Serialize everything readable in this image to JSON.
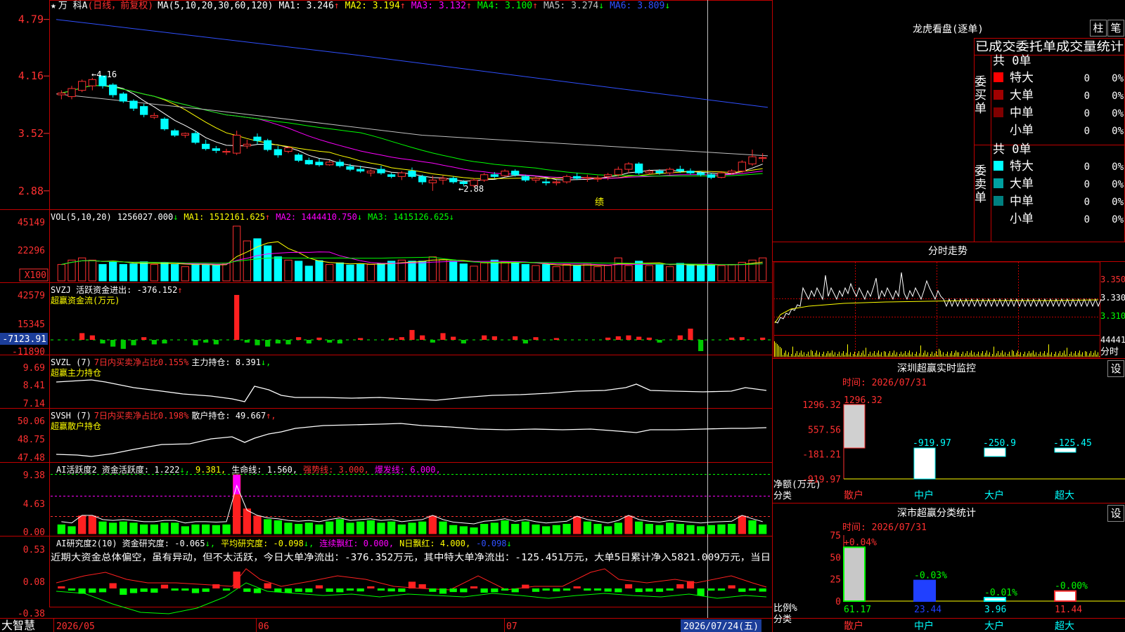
{
  "app_name": "大智慧",
  "title_bar": {
    "star": "★",
    "stock_name": "万 科A",
    "period": "(日线，前复权)",
    "ma_params": "MA(5,10,20,30,60,120)",
    "ma_values": [
      {
        "label": "MA1: 3.246",
        "arrow": "↑",
        "color": "#ffffff"
      },
      {
        "label": "MA2: 3.194",
        "arrow": "↑",
        "color": "#ffff00"
      },
      {
        "label": "MA3: 3.132",
        "arrow": "↑",
        "color": "#ff00ff"
      },
      {
        "label": "MA4: 3.100",
        "arrow": "↑",
        "color": "#00ff00"
      },
      {
        "label": "MA5: 3.274",
        "arrow": "↓",
        "color": "#c0c0c0"
      },
      {
        "label": "MA6: 3.809",
        "arrow": "↓",
        "color": "#3050ff"
      }
    ]
  },
  "price_axis": [
    "4.79",
    "4.16",
    "3.52",
    "2.88"
  ],
  "price_annotations": {
    "high": "←4.16",
    "low": "←2.88",
    "event": "绩"
  },
  "vol_pane": {
    "header": "VOL(5,10,20)",
    "items": [
      {
        "label": "1256027.000",
        "arrow": "↓",
        "color": "#ffffff"
      },
      {
        "label": "MA1: 1512161.625",
        "arrow": "↑",
        "color": "#ffff00"
      },
      {
        "label": "MA2: 1444410.750",
        "arrow": "↓",
        "color": "#ff00ff"
      },
      {
        "label": "MA3: 1415126.625",
        "arrow": "↓",
        "color": "#00ff00"
      }
    ],
    "axis": [
      "45149",
      "22296"
    ],
    "unit": "X100"
  },
  "svzj_pane": {
    "header": "SVZJ 活跃资金进出: -376.152",
    "arrow": "↑",
    "subtitle": "超赢资金流(万元)",
    "axis": [
      "42579",
      "15345",
      "-11890"
    ],
    "current": "-7123.91"
  },
  "svzl_pane": {
    "header": "SVZL (7)",
    "ratio": "7日内买卖净占比0.155%",
    "hold": "主力持仓: 8.391",
    "arrow": "↓,",
    "subtitle": "超赢主力持仓",
    "axis": [
      "9.69",
      "8.41",
      "7.14"
    ]
  },
  "svsh_pane": {
    "header": "SVSH (7)",
    "ratio": "7日内买卖净占比0.198%",
    "hold": "散户持仓: 49.667",
    "arrow": "↑,",
    "subtitle": "超赢散户持仓",
    "axis": [
      "50.06",
      "48.75",
      "47.48"
    ]
  },
  "ai1_pane": {
    "items": [
      {
        "label": "AI活跃度2 资金活跃度: 1.222",
        "arrow": "↓,",
        "color": "#ffffff"
      },
      {
        "label": "9.381,",
        "arrow": "",
        "color": "#ffff00"
      },
      {
        "label": "生命线: 1.560,",
        "arrow": "",
        "color": "#ffffff"
      },
      {
        "label": "强势线: 3.000,",
        "arrow": "",
        "color": "#ff3030"
      },
      {
        "label": "爆发线: 6.000,",
        "arrow": "",
        "color": "#ff00ff"
      }
    ],
    "axis": [
      "9.38",
      "4.63",
      "0.00"
    ]
  },
  "ai2_pane": {
    "items": [
      {
        "label": "AI研究度2(10) 资金研究度: -0.065",
        "arrow": "↓,",
        "color": "#ffffff"
      },
      {
        "label": "平均研究度: -0.098",
        "arrow": "↓,",
        "color": "#ffff00"
      },
      {
        "label": "连续飘红: 0.000,",
        "arrow": "",
        "color": "#ff00ff"
      },
      {
        "label": "N日飘红: 4.000,",
        "arrow": "",
        "color": "#ffff00"
      },
      {
        "label": "-0.098",
        "arrow": "↓",
        "color": "#3050ff"
      }
    ],
    "comment": "近期大资金总体偏空，虽有异动，但不太活跃，今日大单净流出：-376.352万元，其中特大单净流出：-125.451万元，大单5日累计净入5821.009万元，当日",
    "axis": [
      "0.53",
      "0.08",
      "-0.38"
    ]
  },
  "date_axis": {
    "labels": [
      "2026/05",
      "06",
      "07"
    ],
    "current": "2026/07/24(五)"
  },
  "right_panel": {
    "lhb_title": "龙虎看盘(逐单)",
    "btn_zhu": "柱",
    "btn_bi": "笔",
    "order_title": "已成交委托单成交量统计",
    "buy_side": {
      "label": "委买单",
      "total": "共 0单",
      "rows": [
        {
          "name": "特大",
          "value": "0",
          "pct": "0%",
          "color": "#ff0000"
        },
        {
          "name": "大单",
          "value": "0",
          "pct": "0%",
          "color": "#a00000"
        },
        {
          "name": "中单",
          "value": "0",
          "pct": "0%",
          "color": "#800000"
        },
        {
          "name": "小单",
          "value": "0",
          "pct": "0%",
          "color": ""
        }
      ]
    },
    "sell_side": {
      "label": "委卖单",
      "total": "共 0单",
      "rows": [
        {
          "name": "特大",
          "value": "0",
          "pct": "0%",
          "color": "#00ffff"
        },
        {
          "name": "大单",
          "value": "0",
          "pct": "0%",
          "color": "#00a0a0"
        },
        {
          "name": "中单",
          "value": "0",
          "pct": "0%",
          "color": "#008080"
        },
        {
          "name": "小单",
          "value": "0",
          "pct": "0%",
          "color": ""
        }
      ]
    },
    "intraday_title": "分时走势",
    "intraday_axis": [
      "3.350",
      "3.330",
      "3.310"
    ],
    "intraday_vol_label": "44441",
    "intraday_tail": "分时",
    "monitor": {
      "title": "深圳超赢实时监控",
      "set": "设",
      "time": "时间: 2026/07/31",
      "axis": [
        "1296.32",
        "557.56",
        "-181.21",
        "-919.97"
      ],
      "unit": "净额(万元)",
      "cat_label": "分类",
      "values": [
        "1296.32",
        "-919.97",
        "-250.9",
        "-125.45"
      ],
      "categories": [
        "散户",
        "中户",
        "大户",
        "超大"
      ]
    },
    "classify": {
      "title": "深市超赢分类统计",
      "set": "设",
      "time": "时间: 2026/07/31",
      "axis": [
        "75",
        "50",
        "25",
        "0"
      ],
      "unit": "比例%",
      "cat_label": "分类",
      "tops": [
        "+0.04%",
        "-0.03%",
        "-0.01%",
        "-0.00%"
      ],
      "values": [
        "61.17",
        "23.44",
        "3.96",
        "11.44"
      ],
      "categories": [
        "散户",
        "中户",
        "大户",
        "超大"
      ]
    }
  },
  "chart_data": {
    "type": "candlestick",
    "ylim": [
      2.8,
      4.85
    ],
    "ohlc": [
      [
        3.95,
        4.0,
        3.9,
        3.97
      ],
      [
        3.93,
        4.05,
        3.9,
        4.02
      ],
      [
        4.0,
        4.12,
        3.98,
        4.1
      ],
      [
        4.05,
        4.14,
        4.0,
        4.12
      ],
      [
        4.16,
        4.16,
        4.02,
        4.05
      ],
      [
        4.06,
        4.08,
        3.92,
        3.95
      ],
      [
        3.96,
        3.98,
        3.86,
        3.88
      ],
      [
        3.88,
        3.9,
        3.77,
        3.8
      ],
      [
        3.82,
        3.85,
        3.7,
        3.73
      ],
      [
        3.7,
        3.75,
        3.68,
        3.72
      ],
      [
        3.68,
        3.7,
        3.55,
        3.57
      ],
      [
        3.55,
        3.57,
        3.48,
        3.5
      ],
      [
        3.5,
        3.53,
        3.47,
        3.52
      ],
      [
        3.52,
        3.55,
        3.4,
        3.42
      ],
      [
        3.4,
        3.45,
        3.33,
        3.35
      ],
      [
        3.35,
        3.38,
        3.3,
        3.33
      ],
      [
        3.32,
        3.35,
        3.28,
        3.32
      ],
      [
        3.3,
        3.55,
        3.28,
        3.5
      ],
      [
        3.38,
        3.45,
        3.35,
        3.4
      ],
      [
        3.48,
        3.52,
        3.4,
        3.44
      ],
      [
        3.44,
        3.46,
        3.32,
        3.34
      ],
      [
        3.34,
        3.38,
        3.25,
        3.28
      ],
      [
        3.32,
        3.38,
        3.3,
        3.36
      ],
      [
        3.28,
        3.3,
        3.2,
        3.22
      ],
      [
        3.22,
        3.25,
        3.17,
        3.18
      ],
      [
        3.2,
        3.24,
        3.15,
        3.17
      ],
      [
        3.17,
        3.22,
        3.16,
        3.2
      ],
      [
        3.2,
        3.23,
        3.14,
        3.16
      ],
      [
        3.15,
        3.18,
        3.1,
        3.12
      ],
      [
        3.12,
        3.16,
        3.08,
        3.1
      ],
      [
        3.08,
        3.12,
        3.04,
        3.1
      ],
      [
        3.12,
        3.16,
        3.06,
        3.08
      ],
      [
        3.06,
        3.08,
        3.02,
        3.04
      ],
      [
        3.04,
        3.1,
        3.0,
        3.08
      ],
      [
        3.1,
        3.14,
        3.02,
        3.04
      ],
      [
        3.04,
        3.06,
        2.95,
        2.98
      ],
      [
        2.97,
        3.05,
        2.88,
        3.0
      ],
      [
        3.0,
        3.05,
        2.95,
        3.02
      ],
      [
        3.02,
        3.04,
        2.96,
        2.98
      ],
      [
        2.98,
        3.0,
        2.93,
        2.96
      ],
      [
        2.94,
        3.02,
        2.92,
        3.0
      ],
      [
        3.0,
        3.08,
        2.98,
        3.06
      ],
      [
        3.06,
        3.09,
        3.02,
        3.04
      ],
      [
        3.05,
        3.12,
        3.04,
        3.1
      ],
      [
        3.1,
        3.12,
        3.04,
        3.06
      ],
      [
        3.04,
        3.06,
        2.98,
        3.0
      ],
      [
        3.0,
        3.04,
        2.97,
        3.02
      ],
      [
        2.98,
        3.02,
        2.94,
        2.97
      ],
      [
        2.97,
        3.0,
        2.94,
        2.98
      ],
      [
        2.98,
        3.06,
        2.96,
        3.04
      ],
      [
        3.04,
        3.08,
        3.0,
        3.02
      ],
      [
        3.02,
        3.06,
        2.98,
        3.03
      ],
      [
        3.01,
        3.05,
        2.98,
        3.02
      ],
      [
        3.04,
        3.08,
        3.0,
        3.06
      ],
      [
        3.06,
        3.15,
        3.04,
        3.12
      ],
      [
        3.12,
        3.2,
        3.08,
        3.18
      ],
      [
        3.18,
        3.2,
        3.06,
        3.08
      ],
      [
        3.08,
        3.12,
        3.06,
        3.1
      ],
      [
        3.1,
        3.12,
        3.06,
        3.08
      ],
      [
        3.08,
        3.14,
        3.06,
        3.12
      ],
      [
        3.12,
        3.16,
        3.08,
        3.1
      ],
      [
        3.1,
        3.13,
        3.06,
        3.08
      ],
      [
        3.08,
        3.1,
        3.04,
        3.06
      ],
      [
        3.06,
        3.08,
        3.01,
        3.03
      ],
      [
        3.03,
        3.1,
        3.02,
        3.08
      ],
      [
        3.08,
        3.12,
        3.06,
        3.1
      ],
      [
        3.1,
        3.22,
        3.08,
        3.2
      ],
      [
        3.18,
        3.34,
        3.16,
        3.26
      ],
      [
        3.25,
        3.3,
        3.2,
        3.25
      ]
    ],
    "vol": [
      0.3,
      0.38,
      0.42,
      0.38,
      0.3,
      0.34,
      0.3,
      0.31,
      0.35,
      0.3,
      0.33,
      0.3,
      0.26,
      0.31,
      0.3,
      0.29,
      0.32,
      1.0,
      0.73,
      0.77,
      0.64,
      0.44,
      0.38,
      0.36,
      0.27,
      0.37,
      0.3,
      0.33,
      0.29,
      0.3,
      0.3,
      0.32,
      0.36,
      0.38,
      0.36,
      0.36,
      0.44,
      0.39,
      0.36,
      0.31,
      0.27,
      0.33,
      0.38,
      0.35,
      0.33,
      0.3,
      0.28,
      0.3,
      0.26,
      0.3,
      0.28,
      0.31,
      0.26,
      0.28,
      0.42,
      0.28,
      0.36,
      0.28,
      0.3,
      0.26,
      0.32,
      0.3,
      0.28,
      0.3,
      0.28,
      0.3,
      0.34,
      0.38,
      0.42
    ],
    "svzj": [
      0,
      0,
      0.15,
      0.1,
      -0.08,
      -0.15,
      -0.2,
      -0.12,
      0.06,
      -0.1,
      -0.08,
      0,
      0,
      -0.12,
      -0.06,
      -0.1,
      0,
      1.0,
      -0.06,
      -0.12,
      -0.15,
      -0.08,
      -0.1,
      0.06,
      -0.08,
      0.05,
      -0.06,
      -0.08,
      0,
      0.04,
      0,
      0,
      0.04,
      0.06,
      0.22,
      0.1,
      -0.06,
      0.15,
      0.07,
      -0.08,
      0,
      0.1,
      0.08,
      0,
      0.08,
      -0.08,
      0.06,
      0,
      0.04,
      0,
      0,
      0,
      0,
      0.05,
      0.08,
      0.1,
      0.07,
      0.05,
      -0.06,
      0,
      0.1,
      0.25,
      -0.25,
      0,
      0,
      0.05,
      0.06,
      0,
      0.05
    ],
    "ai1": [
      0.15,
      0.12,
      0.3,
      0.3,
      0.2,
      0.18,
      0.2,
      0.18,
      0.15,
      0.15,
      0.18,
      0.18,
      0.12,
      0.15,
      0.15,
      0.14,
      0.15,
      1.0,
      0.42,
      0.3,
      0.24,
      0.22,
      0.18,
      0.16,
      0.18,
      0.15,
      0.2,
      0.24,
      0.18,
      0.2,
      0.22,
      0.18,
      0.2,
      0.15,
      0.18,
      0.2,
      0.3,
      0.2,
      0.14,
      0.12,
      0.1,
      0.16,
      0.18,
      0.22,
      0.16,
      0.2,
      0.15,
      0.12,
      0.14,
      0.16,
      0.28,
      0.2,
      0.16,
      0.12,
      0.18,
      0.3,
      0.2,
      0.16,
      0.14,
      0.18,
      0.16,
      0.14,
      0.12,
      0.14,
      0.15,
      0.16,
      0.3,
      0.22,
      0.15
    ]
  }
}
